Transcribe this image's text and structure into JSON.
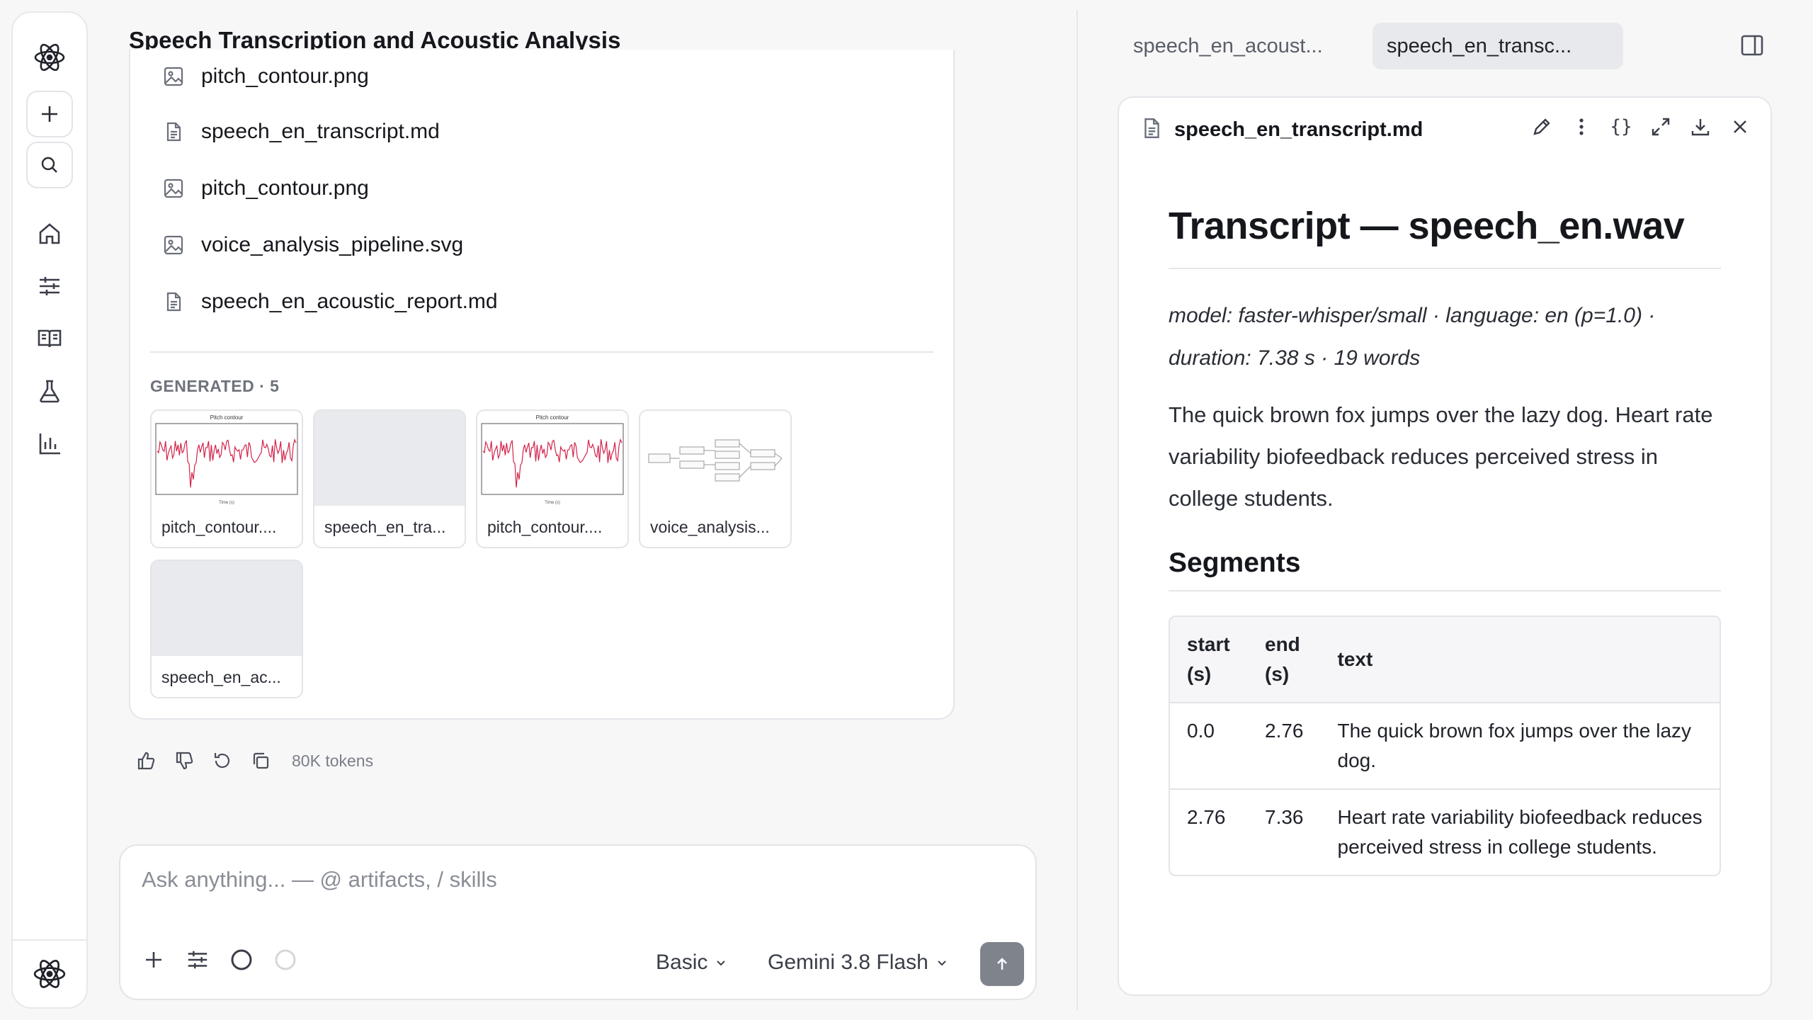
{
  "chat": {
    "title": "Speech Transcription and Acoustic Analysis",
    "files": [
      {
        "name": "pitch_contour.png",
        "icon": "image-icon"
      },
      {
        "name": "speech_en_transcript.md",
        "icon": "document-icon"
      },
      {
        "name": "pitch_contour.png",
        "icon": "image-icon"
      },
      {
        "name": "voice_analysis_pipeline.svg",
        "icon": "image-icon"
      },
      {
        "name": "speech_en_acoustic_report.md",
        "icon": "document-icon"
      }
    ],
    "generated_label": "GENERATED · 5",
    "thumbnails": [
      {
        "caption": "pitch_contour....",
        "kind": "chart",
        "chart_title": "Pitch contour",
        "axis_label": "Time (s)"
      },
      {
        "caption": "speech_en_tra...",
        "kind": "document"
      },
      {
        "caption": "pitch_contour....",
        "kind": "chart",
        "chart_title": "Pitch contour",
        "axis_label": "Time (s)"
      },
      {
        "caption": "voice_analysis...",
        "kind": "diagram"
      },
      {
        "caption": "speech_en_ac...",
        "kind": "document"
      }
    ],
    "tokens": "80K tokens"
  },
  "composer": {
    "placeholder": "Ask anything... — @ artifacts, / skills",
    "mode": "Basic",
    "model": "Gemini 3.8 Flash"
  },
  "tabs": [
    {
      "label": "speech_en_acoust...",
      "active": false
    },
    {
      "label": "speech_en_transc...",
      "active": true
    }
  ],
  "viewer": {
    "filename": "speech_en_transcript.md",
    "tools": [
      "pencil-icon",
      "more-icon",
      "code-icon",
      "expand-icon",
      "download-icon",
      "close-icon"
    ],
    "code_glyph": "{}",
    "heading": "Transcript — speech_en.wav",
    "meta_line1": "model: faster-whisper/small · language: en (p=1.0) ·",
    "meta_line2": "duration: 7.38 s · 19 words",
    "body": "The quick brown fox jumps over the lazy dog. Heart rate variability biofeedback reduces perceived stress in college students.",
    "segments_heading": "Segments",
    "table": {
      "headers": [
        "start (s)",
        "end (s)",
        "text"
      ],
      "rows": [
        [
          "0.0",
          "2.76",
          "The quick brown fox jumps over the lazy dog."
        ],
        [
          "2.76",
          "7.36",
          "Heart rate variability biofeedback reduces perceived stress in college students."
        ]
      ]
    }
  },
  "colors": {
    "accent_send": "#7f838c",
    "pitch_line": "#d2234a"
  }
}
